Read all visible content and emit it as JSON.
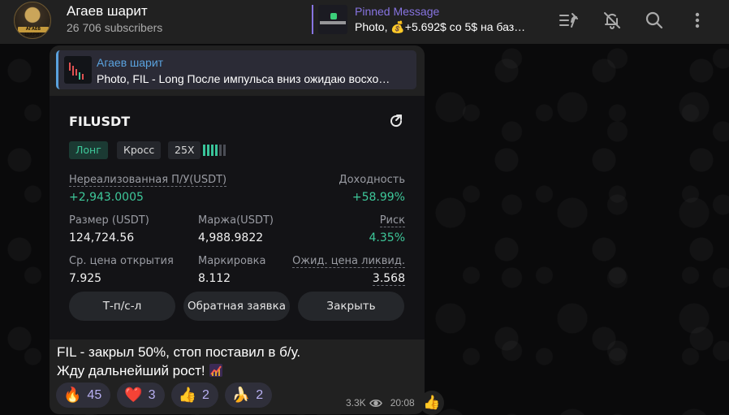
{
  "channel": {
    "title": "Агаев шарит",
    "subtitle": "26 706 subscribers",
    "avatar_text": "АГАЕВ ШАРИТ"
  },
  "pinned": {
    "title": "Pinned Message",
    "text": "Photo, 💰+5.692$ со 5$ на баз…"
  },
  "header_icons": [
    "unpin-list-icon",
    "mute-bell-icon",
    "search-icon",
    "more-vertical-icon"
  ],
  "message": {
    "reply": {
      "author": "Агаев шарит",
      "text": "Photo, FIL - Long После импульса вниз ожидаю восхо…"
    },
    "position_card": {
      "symbol": "FILUSDT",
      "tags": [
        "Лонг",
        "Кросс",
        "25X"
      ],
      "leverage_bars_on": 4,
      "leverage_bars_total": 6,
      "unrealized_label": "Нереализованная П/У(USDT)",
      "unrealized_value": "+2,943.0005",
      "yield_label": "Доходность",
      "yield_value": "+58.99%",
      "size_label": "Размер (USDT)",
      "size_value": "124,724.56",
      "margin_label": "Маржа(USDT)",
      "margin_value": "4,988.9822",
      "risk_label": "Риск",
      "risk_value": "4.35%",
      "entry_label": "Ср. цена открытия",
      "entry_value": "7.925",
      "mark_label": "Маркировка",
      "mark_value": "8.112",
      "liq_label": "Ожид. цена ликвид.",
      "liq_value": "3.568",
      "buttons": [
        "Т-п/с-л",
        "Обратная заявка",
        "Закрыть"
      ]
    },
    "text_line1": "FIL - закрыл 50%, стоп поставил в б/у.",
    "text_line2": "Жду дальнейший рост!",
    "reactions": [
      {
        "emoji": "🔥",
        "count": "45"
      },
      {
        "emoji": "❤️",
        "count": "3"
      },
      {
        "emoji": "👍",
        "count": "2"
      },
      {
        "emoji": "🍌",
        "count": "2"
      }
    ],
    "views": "3.3K",
    "time": "20:08",
    "quick_reaction": "👍"
  },
  "colors": {
    "accent": "#8774e1",
    "link": "#5aa2de",
    "profit_green": "#3ec89a",
    "bubble_bg": "#212121",
    "header_bg": "#212121"
  }
}
